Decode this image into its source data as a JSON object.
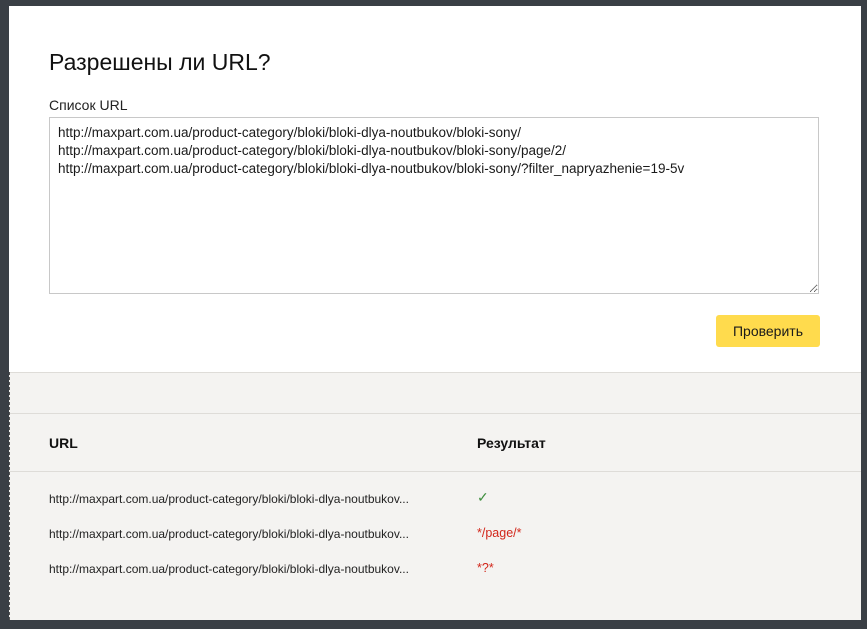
{
  "page": {
    "title": "Разрешены ли URL?",
    "url_list_label": "Список URL",
    "url_list_value": "http://maxpart.com.ua/product-category/bloki/bloki-dlya-noutbukov/bloki-sony/\nhttp://maxpart.com.ua/product-category/bloki/bloki-dlya-noutbukov/bloki-sony/page/2/\nhttp://maxpart.com.ua/product-category/bloki/bloki-dlya-noutbukov/bloki-sony/?filter_napryazhenie=19-5v",
    "check_button_label": "Проверить"
  },
  "results": {
    "columns": {
      "url": "URL",
      "result": "Результат"
    },
    "rows": [
      {
        "url": "http://maxpart.com.ua/product-category/bloki/bloki-dlya-noutbukov...",
        "result": "✓",
        "status": "allowed"
      },
      {
        "url": "http://maxpart.com.ua/product-category/bloki/bloki-dlya-noutbukov...",
        "result": "*/page/*",
        "status": "blocked"
      },
      {
        "url": "http://maxpart.com.ua/product-category/bloki/bloki-dlya-noutbukov...",
        "result": "*?*",
        "status": "blocked"
      }
    ]
  },
  "colors": {
    "button": "#ffdb4d",
    "allowed": "#3f8f3f",
    "blocked": "#d2261a",
    "results_bg": "#f4f3f1"
  }
}
